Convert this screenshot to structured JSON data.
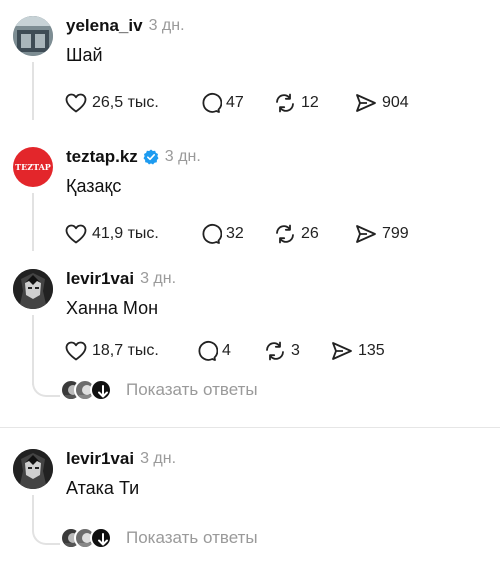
{
  "posts": [
    {
      "username": "yelena_iv",
      "time": "3 дн.",
      "text": "Шай",
      "likes": "26,5 тыс.",
      "comments": "47",
      "reposts": "12",
      "shares": "904"
    },
    {
      "username": "teztap.kz",
      "verified": true,
      "avatar_text": "TEZTAP",
      "time": "3 дн.",
      "text": "Қазақс",
      "likes": "41,9 тыс.",
      "comments": "32",
      "reposts": "26",
      "shares": "799"
    },
    {
      "username": "levir1vai",
      "time": "3 дн.",
      "text": "Ханна Мон",
      "likes": "18,7 тыс.",
      "comments": "4",
      "reposts": "3",
      "shares": "135",
      "show_replies": "Показать ответы"
    },
    {
      "username": "levir1vai",
      "time": "3 дн.",
      "text": "Атака Ти",
      "show_replies": "Показать ответы"
    }
  ],
  "colors": {
    "verified": "#1d9bf0",
    "teztap_red": "#e3262b",
    "muted": "#9a9a9a"
  },
  "icons": [
    "heart-icon",
    "comment-icon",
    "repost-icon",
    "share-icon",
    "verified-icon",
    "arrow-down-icon"
  ]
}
